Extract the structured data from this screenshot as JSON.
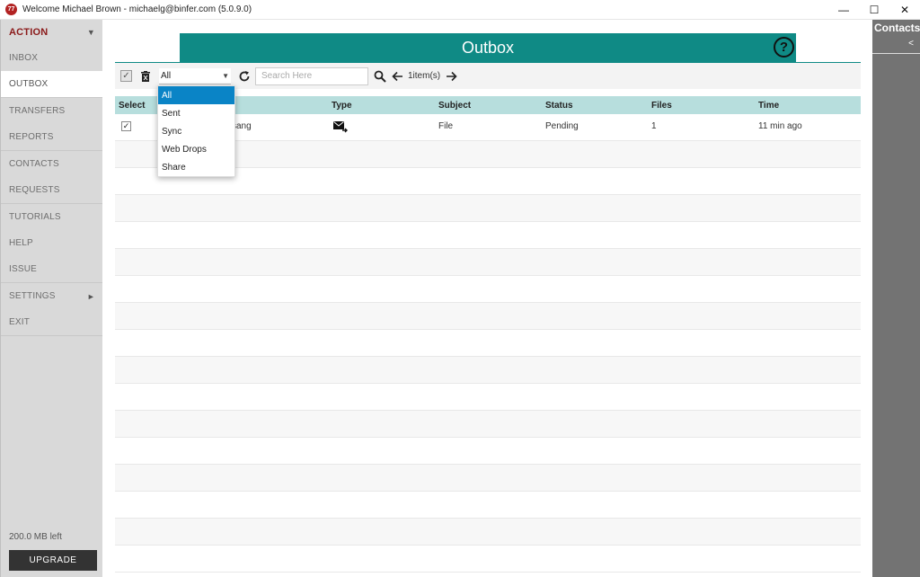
{
  "window": {
    "title": "Welcome  Michael Brown - michaelg@binfer.com (5.0.9.0)",
    "logo_text": "77",
    "minimize": "—",
    "maximize": "☐",
    "close": "✕"
  },
  "sidebar": {
    "items": [
      {
        "label": "ACTION"
      },
      {
        "label": "INBOX"
      },
      {
        "label": "OUTBOX"
      },
      {
        "label": "TRANSFERS"
      },
      {
        "label": "REPORTS"
      },
      {
        "label": "CONTACTS"
      },
      {
        "label": "REQUESTS"
      },
      {
        "label": "TUTORIALS"
      },
      {
        "label": "HELP"
      },
      {
        "label": "ISSUE"
      },
      {
        "label": "SETTINGS"
      },
      {
        "label": "EXIT"
      }
    ],
    "storage_left": "200.0 MB left",
    "upgrade_label": "UPGRADE"
  },
  "header": {
    "title": "Outbox",
    "help": "?"
  },
  "toolbar": {
    "filter_value": "All",
    "search_placeholder": "Search Here",
    "items_count": "1item(s)"
  },
  "dropdown": {
    "options": [
      "All",
      "Sent",
      "Sync",
      "Web Drops",
      "Share"
    ]
  },
  "table": {
    "columns": [
      "Select",
      "Type",
      "Subject",
      "Status",
      "Files",
      "Time"
    ],
    "rows": [
      {
        "recipient_fragment": "sang",
        "subject": "File",
        "status": "Pending",
        "files": "1",
        "time": "11 min ago",
        "checked": "✓"
      }
    ]
  },
  "right_panel": {
    "title": "Contacts",
    "collapse": "<"
  },
  "colors": {
    "accent": "#0f8a85",
    "table_header": "#b7dedd",
    "action_text": "#8b1a1a",
    "dropdown_selected": "#0a84c6"
  }
}
